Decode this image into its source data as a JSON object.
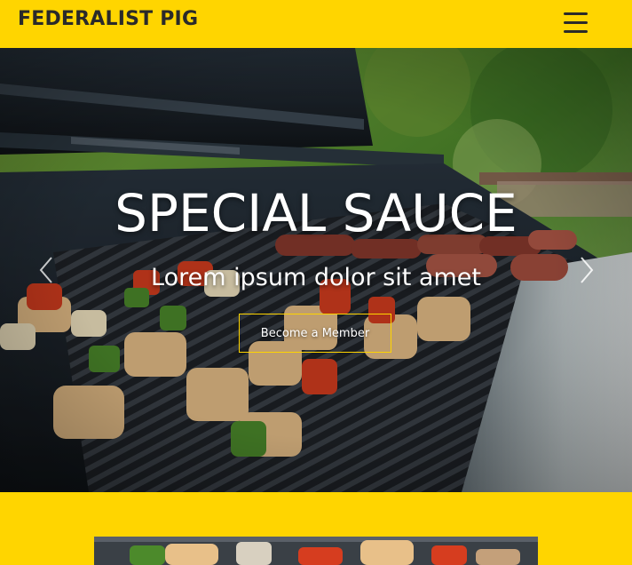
{
  "header": {
    "brand": "FEDERALIST PIG",
    "menu_icon": "hamburger-menu-icon"
  },
  "hero": {
    "title": "SPECIAL SAUCE",
    "subtitle": "Lorem ipsum dolor sit amet",
    "cta_label": "Become a Member",
    "prev_icon": "chevron-left-icon",
    "next_icon": "chevron-right-icon"
  },
  "colors": {
    "accent": "#ffd500",
    "text_dark": "#2a2a2a",
    "text_light": "#ffffff"
  }
}
